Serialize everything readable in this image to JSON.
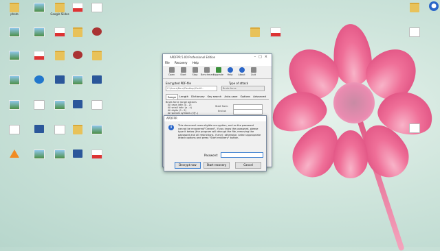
{
  "desktop_icons": [
    {
      "label": "photo",
      "type": "folder"
    },
    {
      "label": "",
      "type": "pic"
    },
    {
      "label": "Google Slides",
      "type": "folder"
    },
    {
      "label": "",
      "type": "pdf"
    },
    {
      "label": "",
      "type": "doc"
    },
    {
      "label": "",
      "type": "pic"
    },
    {
      "label": "",
      "type": "pic"
    },
    {
      "label": "",
      "type": "pdf"
    },
    {
      "label": "",
      "type": "folder"
    },
    {
      "label": "",
      "type": "app"
    },
    {
      "label": "",
      "type": "pic"
    },
    {
      "label": "",
      "type": "pdf"
    },
    {
      "label": "",
      "type": "folder"
    },
    {
      "label": "",
      "type": "app"
    },
    {
      "label": "",
      "type": "folder"
    },
    {
      "label": "",
      "type": "pic"
    },
    {
      "label": "",
      "type": "wifi"
    },
    {
      "label": "",
      "type": "word"
    },
    {
      "label": "",
      "type": "pic"
    },
    {
      "label": "",
      "type": "word"
    },
    {
      "label": "",
      "type": "pic"
    },
    {
      "label": "",
      "type": "doc"
    },
    {
      "label": "",
      "type": "pic"
    },
    {
      "label": "",
      "type": "word"
    },
    {
      "label": "",
      "type": "doc"
    },
    {
      "label": "",
      "type": "doc"
    },
    {
      "label": "",
      "type": "word"
    },
    {
      "label": "",
      "type": "doc"
    },
    {
      "label": "",
      "type": "folder"
    },
    {
      "label": "",
      "type": "pic"
    },
    {
      "label": "",
      "type": "vlc"
    },
    {
      "label": "",
      "type": "pic"
    },
    {
      "label": "",
      "type": "pic"
    },
    {
      "label": "",
      "type": "word"
    },
    {
      "label": "",
      "type": "pdf"
    }
  ],
  "right_icons": [
    {
      "label": "",
      "type": "folder"
    },
    {
      "label": "",
      "type": "pdf"
    },
    {
      "label": "",
      "type": "folder"
    },
    {
      "label": "",
      "type": "doc"
    },
    {
      "label": "",
      "type": "doc"
    }
  ],
  "app": {
    "title": "APDFPR 5.00 Professional Edition",
    "menu": [
      "File",
      "Recovery",
      "Help"
    ],
    "toolbar": [
      "Open",
      "Start",
      "Stop",
      "Benchmark",
      "Upgrade",
      "Help",
      "About",
      "Quit"
    ],
    "encrypted_label": "Encrypted PDF-file",
    "attack_label": "Type of attack",
    "file_path": "C:\\Users\\Bern\\Desktop\\Certif...",
    "attack_value": "Brute-force",
    "tabs": [
      "Range",
      "Length",
      "Dictionary",
      "Key search",
      "Auto-save",
      "Options",
      "Advanced"
    ],
    "range_options_label": "Brute-force range options",
    "range_options": [
      "All caps latin (A - Z)",
      "All small latin (a - z)",
      "All digits (0 - 9)",
      "All special symbols (!@..)"
    ],
    "start_from_label": "Start from:",
    "end_at_label": "End at:"
  },
  "dialog": {
    "title": "APDFPR",
    "message": "This document uses eligible encryption, and so the password cannot be recovered/\"Owned\". If you know the password, please type it below (the program will decrypt the file, removing the password and all restrictions, if any); otherwise, select appropriate attack options and press \"Start recovery\" button.",
    "password_label": "Password:",
    "password_value": "",
    "buttons": [
      "Decrypt now",
      "Start recovery",
      "Cancel"
    ]
  },
  "colors": {
    "accent": "#2a66c8",
    "flower": "#ef6f98"
  }
}
